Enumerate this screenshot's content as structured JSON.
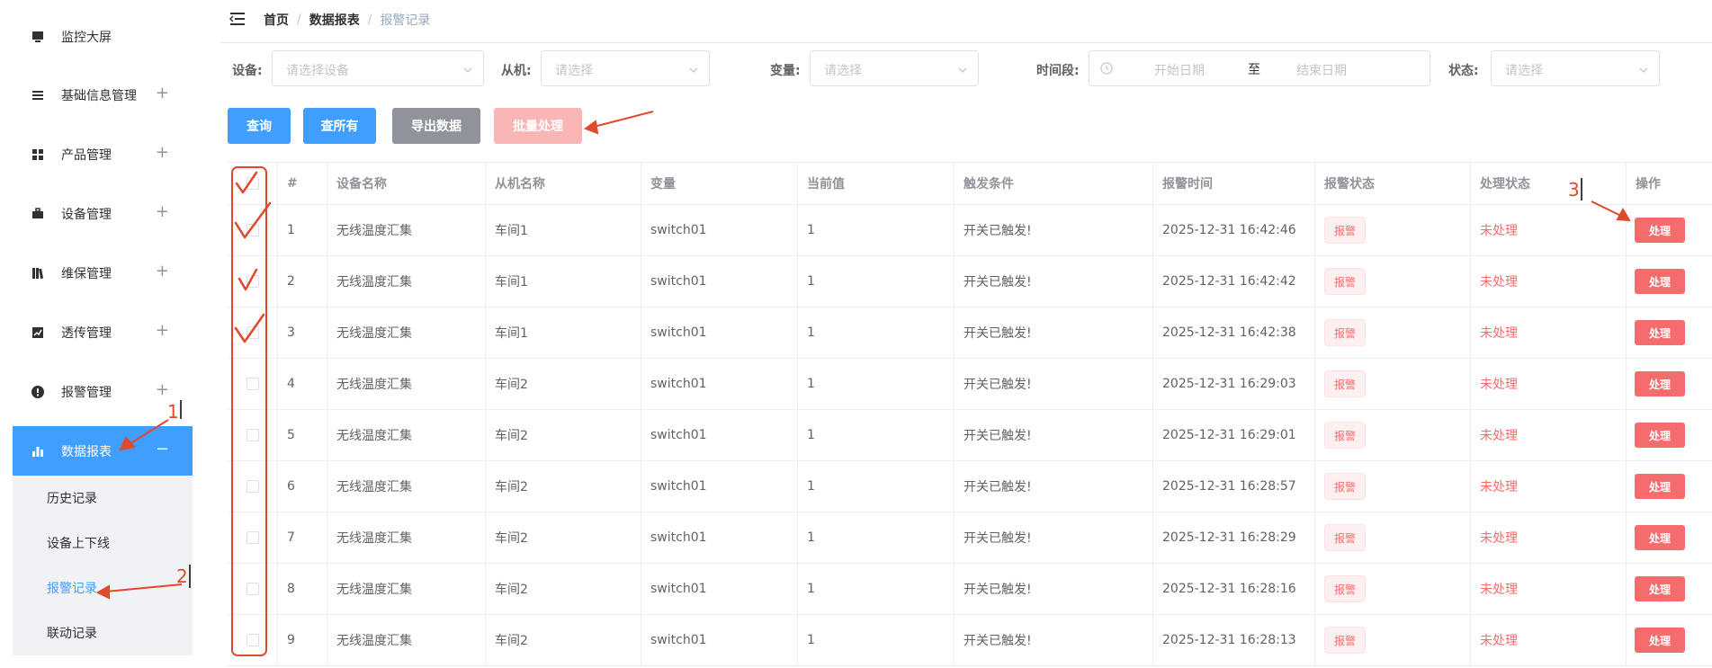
{
  "sidebar": {
    "items": [
      {
        "label": "监控大屏",
        "icon": "monitor-icon",
        "expandable": false
      },
      {
        "label": "基础信息管理",
        "icon": "list-icon",
        "expandable": true
      },
      {
        "label": "产品管理",
        "icon": "grid-icon",
        "expandable": true
      },
      {
        "label": "设备管理",
        "icon": "briefcase-icon",
        "expandable": true
      },
      {
        "label": "维保管理",
        "icon": "books-icon",
        "expandable": true
      },
      {
        "label": "透传管理",
        "icon": "trend-chart-icon",
        "expandable": true
      },
      {
        "label": "报警管理",
        "icon": "alert-circle-icon",
        "expandable": true
      },
      {
        "label": "数据报表",
        "icon": "bar-chart-icon",
        "expandable": true,
        "active": true
      }
    ],
    "expand_symbol": "+",
    "collapse_symbol": "−",
    "submenu": [
      "历史记录",
      "设备上下线",
      "报警记录",
      "联动记录"
    ],
    "active_submenu_index": 2
  },
  "header": {
    "breadcrumb": [
      "首页",
      "数据报表",
      "报警记录"
    ],
    "separator": "/"
  },
  "filters": {
    "device_label": "设备:",
    "device_placeholder": "请选择设备",
    "slave_label": "从机:",
    "slave_placeholder": "请选择",
    "variable_label": "变量:",
    "variable_placeholder": "请选择",
    "period_label": "时间段:",
    "start_placeholder": "开始日期",
    "range_separator": "至",
    "end_placeholder": "结束日期",
    "status_label": "状态:",
    "status_placeholder": "请选择"
  },
  "buttons": {
    "query": "查询",
    "query_all": "查所有",
    "export": "导出数据",
    "batch": "批量处理"
  },
  "table": {
    "columns": [
      "#",
      "设备名称",
      "从机名称",
      "变量",
      "当前值",
      "触发条件",
      "报警时间",
      "报警状态",
      "处理状态",
      "操作"
    ],
    "rows": [
      {
        "index": "1",
        "device": "无线温度汇集",
        "slave": "车间1",
        "variable": "switch01",
        "value": "1",
        "condition": "开关已触发!",
        "time": "2025-12-31 16:42:46",
        "alarm": "报警",
        "handle": "未处理",
        "action": "处理"
      },
      {
        "index": "2",
        "device": "无线温度汇集",
        "slave": "车间1",
        "variable": "switch01",
        "value": "1",
        "condition": "开关已触发!",
        "time": "2025-12-31 16:42:42",
        "alarm": "报警",
        "handle": "未处理",
        "action": "处理"
      },
      {
        "index": "3",
        "device": "无线温度汇集",
        "slave": "车间1",
        "variable": "switch01",
        "value": "1",
        "condition": "开关已触发!",
        "time": "2025-12-31 16:42:38",
        "alarm": "报警",
        "handle": "未处理",
        "action": "处理"
      },
      {
        "index": "4",
        "device": "无线温度汇集",
        "slave": "车间2",
        "variable": "switch01",
        "value": "1",
        "condition": "开关已触发!",
        "time": "2025-12-31 16:29:03",
        "alarm": "报警",
        "handle": "未处理",
        "action": "处理"
      },
      {
        "index": "5",
        "device": "无线温度汇集",
        "slave": "车间2",
        "variable": "switch01",
        "value": "1",
        "condition": "开关已触发!",
        "time": "2025-12-31 16:29:01",
        "alarm": "报警",
        "handle": "未处理",
        "action": "处理"
      },
      {
        "index": "6",
        "device": "无线温度汇集",
        "slave": "车间2",
        "variable": "switch01",
        "value": "1",
        "condition": "开关已触发!",
        "time": "2025-12-31 16:28:57",
        "alarm": "报警",
        "handle": "未处理",
        "action": "处理"
      },
      {
        "index": "7",
        "device": "无线温度汇集",
        "slave": "车间2",
        "variable": "switch01",
        "value": "1",
        "condition": "开关已触发!",
        "time": "2025-12-31 16:28:29",
        "alarm": "报警",
        "handle": "未处理",
        "action": "处理"
      },
      {
        "index": "8",
        "device": "无线温度汇集",
        "slave": "车间2",
        "variable": "switch01",
        "value": "1",
        "condition": "开关已触发!",
        "time": "2025-12-31 16:28:16",
        "alarm": "报警",
        "handle": "未处理",
        "action": "处理"
      },
      {
        "index": "9",
        "device": "无线温度汇集",
        "slave": "车间2",
        "variable": "switch01",
        "value": "1",
        "condition": "开关已触发!",
        "time": "2025-12-31 16:28:13",
        "alarm": "报警",
        "handle": "未处理",
        "action": "处理"
      }
    ]
  },
  "annotations": {
    "n1": "1",
    "n2": "2",
    "n3": "3"
  },
  "colors": {
    "primary": "#409eff",
    "danger": "#f56c6c",
    "annotation": "#e0492b"
  }
}
